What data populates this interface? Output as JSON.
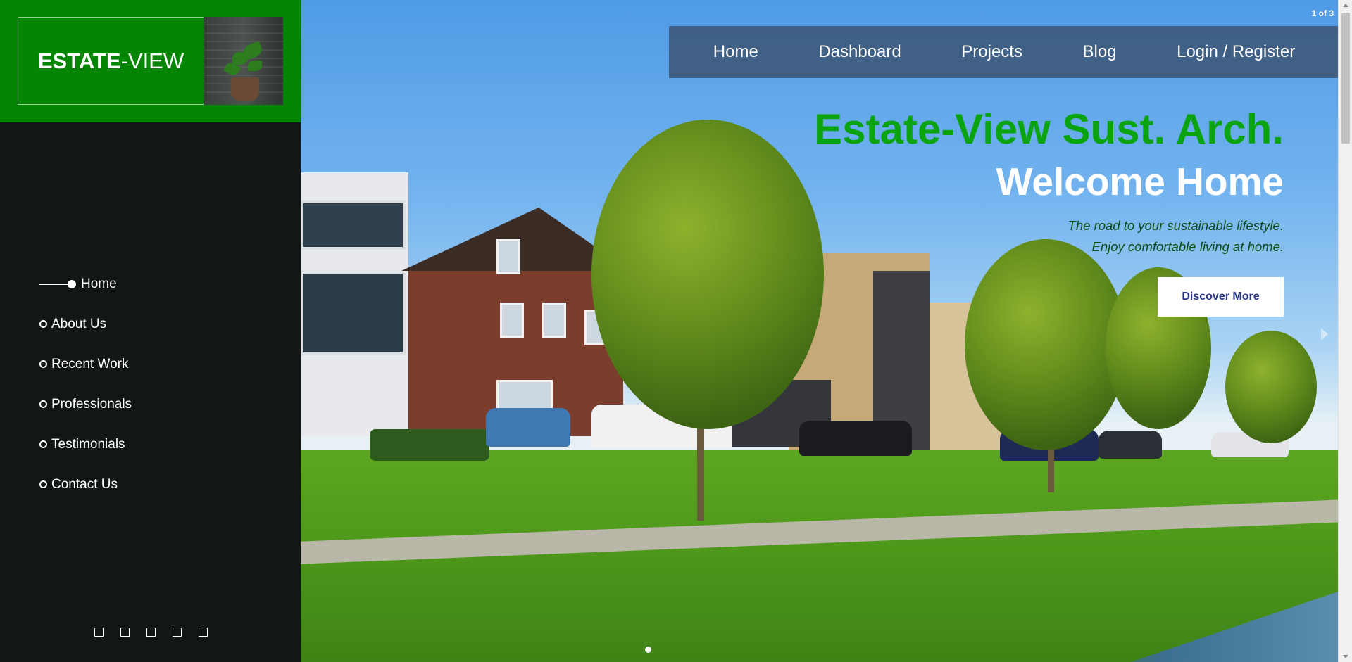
{
  "logo": {
    "bold": "ESTATE",
    "rest": "-VIEW"
  },
  "top_nav": {
    "items": [
      "Home",
      "Dashboard",
      "Projects",
      "Blog",
      "Login / Register"
    ]
  },
  "slide_counter": "1 of 3",
  "hero": {
    "title": "Estate-View Sust. Arch.",
    "subtitle": "Welcome Home",
    "tagline_1": "The road to your sustainable lifestyle.",
    "tagline_2": "Enjoy comfortable living at home.",
    "cta": "Discover More"
  },
  "side_nav": {
    "items": [
      "Home",
      "About Us",
      "Recent Work",
      "Professionals",
      "Testimonials",
      "Contact Us"
    ],
    "active_index": 0
  },
  "side_pager_count": 5,
  "colors": {
    "brand_green": "#048604",
    "title_green": "#0ba310",
    "nav_bg": "#3c5876",
    "cta_text": "#2d3a8c"
  },
  "icons": [
    "next-arrow-icon",
    "slide-dot-icon",
    "nav-dot-icon"
  ]
}
